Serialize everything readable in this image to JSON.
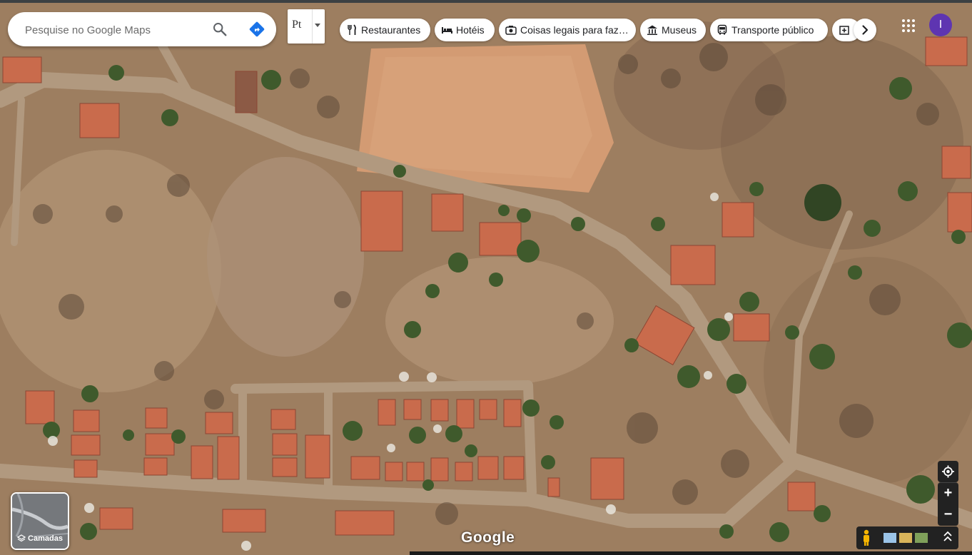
{
  "search": {
    "placeholder": "Pesquise no Google Maps",
    "search_icon": "search-icon",
    "directions_icon": "directions-icon"
  },
  "translate_widget": {
    "label": "Pt",
    "dropdown_icon": "dropdown-arrow-icon"
  },
  "categories": [
    {
      "label": "Restaurantes",
      "icon": "fork-knife-icon"
    },
    {
      "label": "Hotéis",
      "icon": "bed-icon"
    },
    {
      "label": "Coisas legais para faz…",
      "icon": "camera-icon"
    },
    {
      "label": "Museus",
      "icon": "museum-icon"
    },
    {
      "label": "Transporte público",
      "icon": "bus-icon"
    },
    {
      "label": "",
      "icon": "pharmacy-icon"
    }
  ],
  "account": {
    "initial": "I",
    "color": "#5e35b1"
  },
  "layers": {
    "label": "Camadas"
  },
  "map": {
    "branding": "Google",
    "view": "satellite"
  },
  "controls": {
    "zoom_in": "+",
    "zoom_out": "−"
  }
}
